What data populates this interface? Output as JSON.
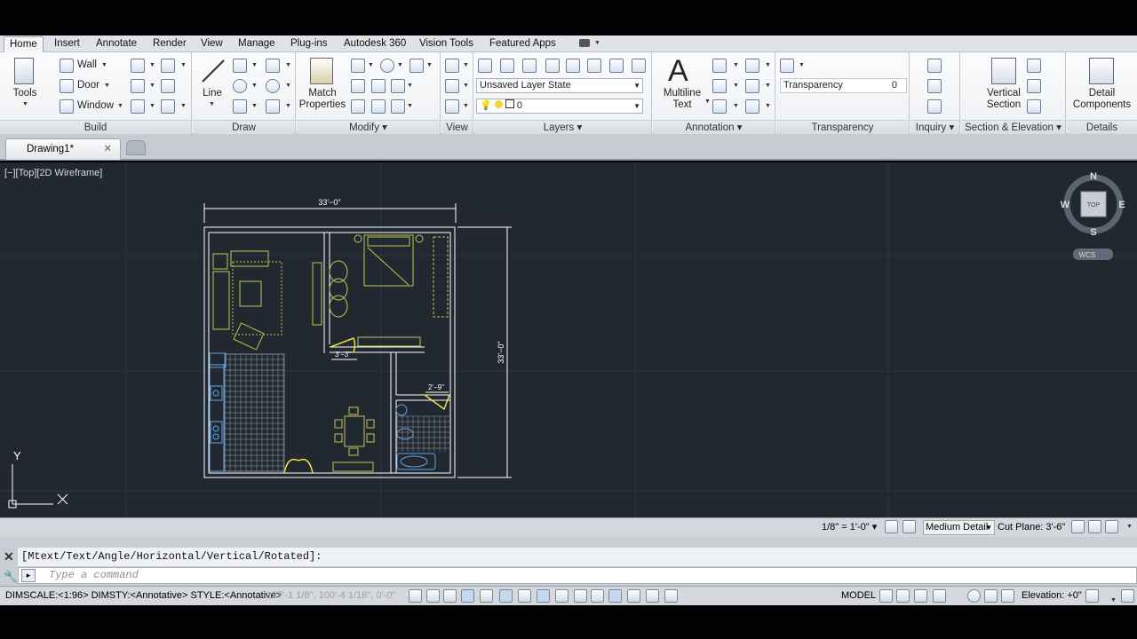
{
  "ribbon_tabs": [
    "Home",
    "Insert",
    "Annotate",
    "Render",
    "View",
    "Manage",
    "Plug-ins",
    "Autodesk 360",
    "Vision Tools",
    "Featured Apps"
  ],
  "build": {
    "title": "Build",
    "tools": "Tools",
    "wall": "Wall",
    "door": "Door",
    "window": "Window"
  },
  "draw": {
    "title": "Draw",
    "line": "Line"
  },
  "modify": {
    "title": "Modify",
    "match": "Match",
    "properties": "Properties"
  },
  "view_panel": {
    "title": "View"
  },
  "layers": {
    "title": "Layers",
    "layer_state": "Unsaved Layer State",
    "layer": "0"
  },
  "annotation": {
    "title": "Annotation",
    "multiline": "Multiline",
    "text": "Text"
  },
  "transparency": {
    "title": "Transparency",
    "label": "Transparency",
    "value": "0"
  },
  "inquiry": {
    "title": "Inquiry"
  },
  "section": {
    "title": "Section & Elevation",
    "vertical": "Vertical",
    "section": "Section"
  },
  "details": {
    "title": "Details",
    "detail": "Detail",
    "components": "Components"
  },
  "document": {
    "tab": "Drawing1*"
  },
  "viewport": {
    "label": "[−][Top][2D Wireframe]"
  },
  "viewcube": {
    "n": "N",
    "s": "S",
    "e": "E",
    "w": "W",
    "top": "TOP",
    "wcs": "WCS"
  },
  "ucs": {
    "x": "X",
    "y": "Y"
  },
  "plan": {
    "dim_top": "33'−0\"",
    "dim_right": "33'−0\"",
    "dim_door1": "3'−3\"",
    "dim_door2": "2'−9\""
  },
  "statusline": {
    "scale": "1/8\" = 1'-0\"",
    "detail": "Medium Detail",
    "cutplane": "Cut Plane: 3'-6\""
  },
  "command": {
    "history": "[Mtext/Text/Angle/Horizontal/Vertical/Rotated]:",
    "placeholder": "Type a command"
  },
  "statusbar": {
    "left": "DIMSCALE:<1:96> DIMSTY:<Annotative> STYLE:<Annotative>",
    "coords": "127'-1 1/8\", 100'-4 1/16\", 0'-0\"",
    "model": "MODEL",
    "elevation": "Elevation: +0\""
  },
  "colors": {
    "canvas": "#212830",
    "walls": "#ffffff",
    "furniture": "#c8c05a",
    "grid": "#2c343d",
    "blue": "#5fa8e8"
  }
}
